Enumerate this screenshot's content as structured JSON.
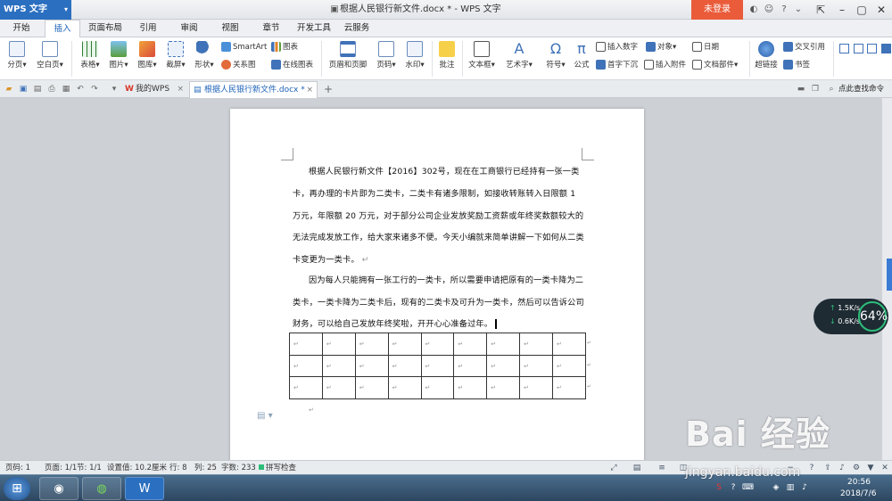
{
  "titlebar": {
    "app_button": "WPS 文字",
    "document_title": "根据人民银行新文件.docx * - WPS 文字",
    "login_button": "未登录"
  },
  "menubar": {
    "tabs": [
      "开始",
      "插入",
      "页面布局",
      "引用",
      "审阅",
      "视图",
      "章节",
      "开发工具",
      "云服务"
    ],
    "active": "插入"
  },
  "ribbon": {
    "big_buttons": [
      "分页",
      "空白页",
      "表格",
      "图片",
      "图库",
      "截屏",
      "形状",
      "页眉和页脚",
      "页码",
      "水印",
      "批注",
      "文本框",
      "艺术字",
      "符号",
      "公式",
      "超链接"
    ],
    "small_buttons": [
      "SmartArt",
      "图表",
      "关系图",
      "在线图表",
      "插入数字",
      "对象",
      "日期",
      "首字下沉",
      "插入附件",
      "文档部件",
      "交叉引用",
      "书签"
    ]
  },
  "tabbar": {
    "home_tab": "我的WPS",
    "doc_tab": "根据人民银行新文件.docx *",
    "add_tab": "+",
    "search_label": "点此查找命令"
  },
  "document": {
    "paragraph1_lines": [
      "根据人民银行新文件【2016】302号，现在在工商银行已经持有一张一类",
      "卡，再办理的卡片即为二类卡，二类卡有诸多限制，如接收转账转入日限额 1",
      "万元，年限额 20 万元，对于部分公司企业发放奖励工资薪或年终奖数额较大的",
      "无法完成发放工作，给大家来诸多不便。今天小编就来简单讲解一下如何从二类",
      "卡变更为一类卡。"
    ],
    "paragraph2_lines": [
      "因为每人只能拥有一张工行的一类卡，所以需要申请把原有的一类卡降为二",
      "类卡，一类卡降为二类卡后，现有的二类卡及可升为一类卡，然后可以告诉公司",
      "财务，可以给自己发放年终奖啦，开开心心准备过年。"
    ],
    "table_rows": 3,
    "table_cols": 9,
    "cell_mark": "↵",
    "para_mark": "↵"
  },
  "net_widget": {
    "upload": "1.5K/s",
    "download": "0.6K/s",
    "percent": "64%"
  },
  "statusbar": {
    "page": "页码: 1",
    "pages": "页面: 1/1",
    "section": "节: 1/1",
    "setting": "设置值: 10.2厘米",
    "row": "行: 8",
    "col": "列: 25",
    "words": "字数: 233",
    "spellcheck": "拼写检查"
  },
  "taskbar": {
    "time": "20:56",
    "date": "2018/7/6"
  },
  "watermark": {
    "text": "Bai 经验",
    "url": "jingyan.baidu.com"
  },
  "colors": {
    "accent": "#2b6fc0",
    "login": "#ea5b3a",
    "active_tab_text": "#1d62b8"
  }
}
